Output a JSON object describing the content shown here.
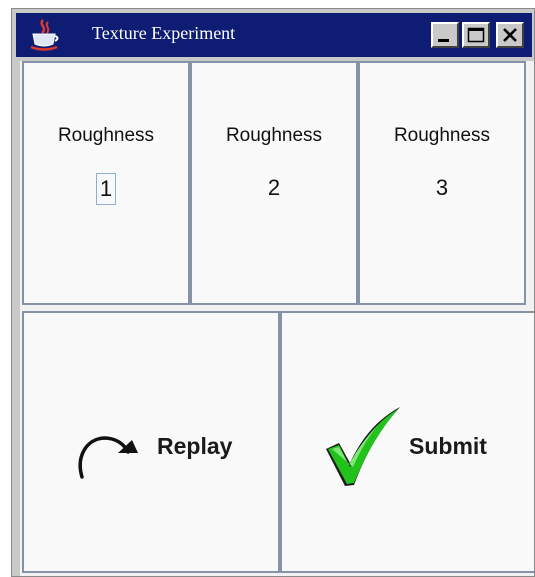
{
  "window": {
    "title": "Texture Experiment",
    "title_bar_color": "#0e1d73",
    "icons": [
      "java-cup-icon",
      "minimize-icon",
      "maximize-icon",
      "close-icon"
    ]
  },
  "roughness_options": [
    {
      "label": "Roughness",
      "value": "1",
      "focused": true
    },
    {
      "label": "Roughness",
      "value": "2",
      "focused": false
    },
    {
      "label": "Roughness",
      "value": "3",
      "focused": false
    }
  ],
  "actions": {
    "replay": {
      "label": "Replay",
      "icon": "replay-arrow-icon"
    },
    "submit": {
      "label": "Submit",
      "icon": "green-checkmark-icon",
      "icon_color": "#22c21d"
    }
  }
}
